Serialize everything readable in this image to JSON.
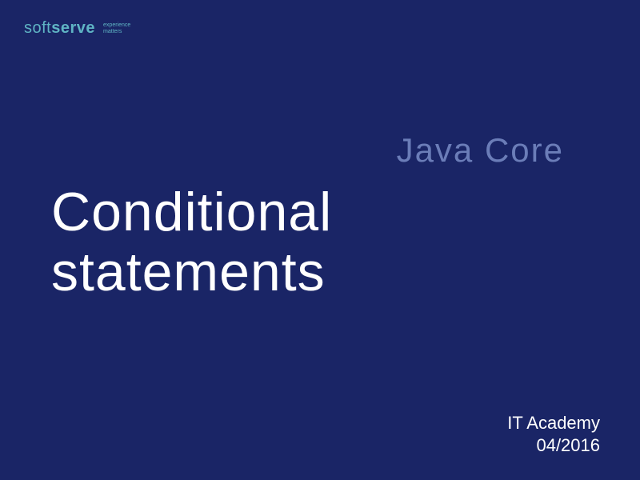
{
  "logo": {
    "part1": "soft",
    "part2": "serve",
    "tagline1": "experience",
    "tagline2": "matters"
  },
  "subtitle": "Java Core",
  "title": "Conditional\nstatements",
  "footer": {
    "line1": "IT Academy",
    "line2": "04/2016"
  }
}
